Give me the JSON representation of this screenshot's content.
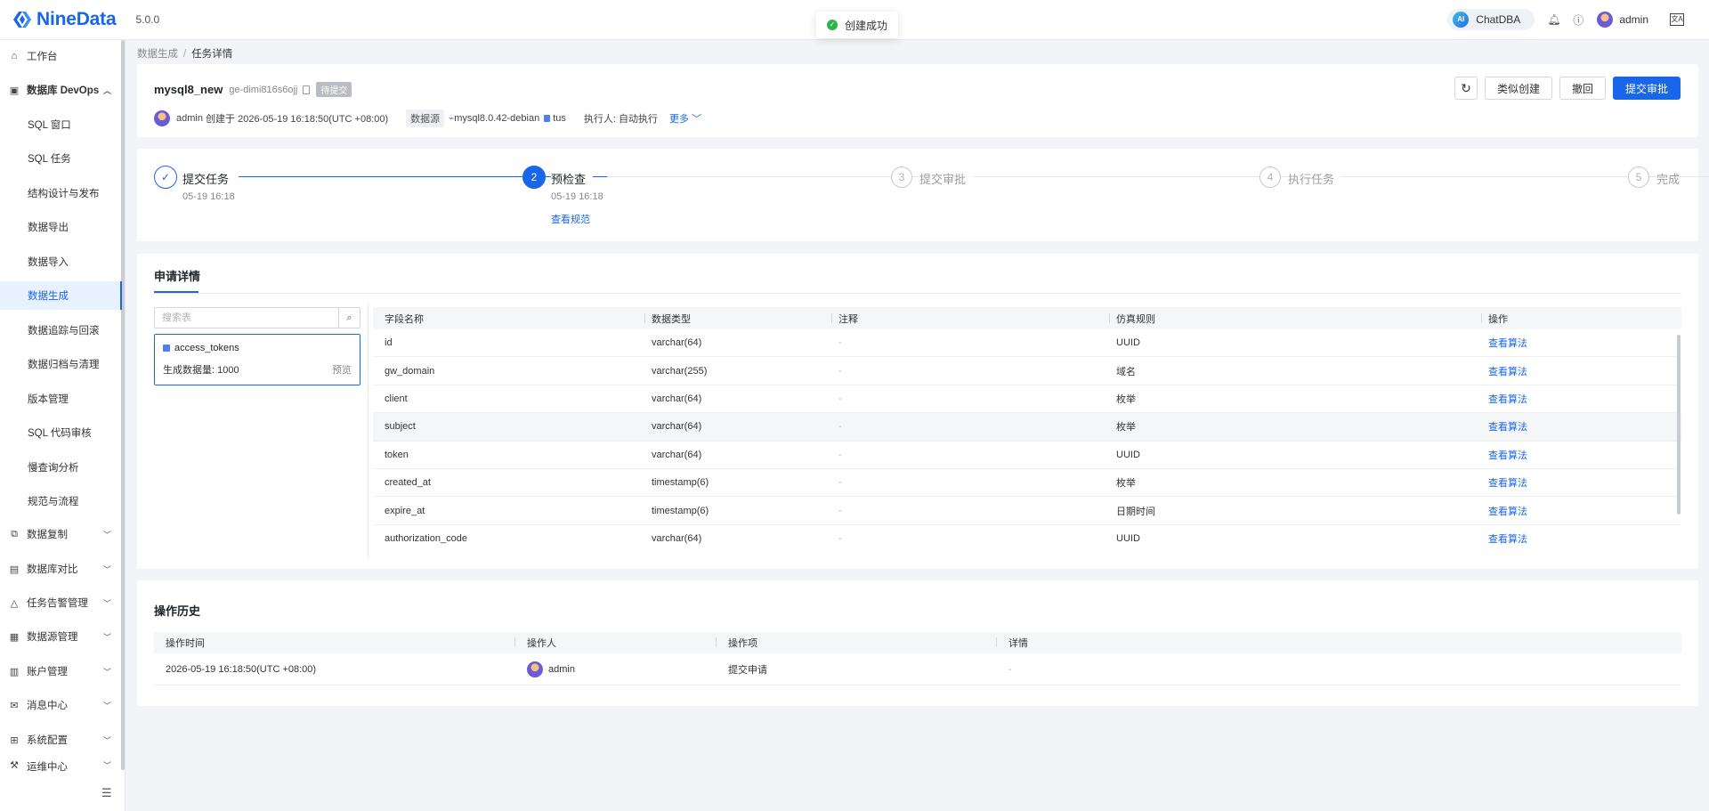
{
  "app": {
    "brand": "NineData",
    "version": "5.0.0",
    "brand_color": "#1a66e8"
  },
  "toast": {
    "message": "创建成功",
    "icon": "check-circle-icon"
  },
  "header": {
    "chatdba_badge": "AI",
    "chatdba_label": "ChatDBA",
    "bell_icon": "bell-icon",
    "help_icon": "help-icon",
    "user_name": "admin",
    "lang_icon": "language-icon"
  },
  "sidebar": {
    "items": [
      {
        "label": "工作台",
        "icon": "home-icon"
      },
      {
        "label": "数据库 DevOps",
        "icon": "devops-icon"
      },
      {
        "label": "SQL 窗口"
      },
      {
        "label": "SQL 任务"
      },
      {
        "label": "结构设计与发布"
      },
      {
        "label": "数据导出"
      },
      {
        "label": "数据导入"
      },
      {
        "label": "数据生成"
      },
      {
        "label": "数据追踪与回滚"
      },
      {
        "label": "数据归档与清理"
      },
      {
        "label": "版本管理"
      },
      {
        "label": "SQL 代码审核"
      },
      {
        "label": "慢查询分析"
      },
      {
        "label": "规范与流程"
      },
      {
        "label": "数据复制",
        "icon": "replication-icon"
      },
      {
        "label": "数据库对比",
        "icon": "compare-icon"
      },
      {
        "label": "任务告警管理",
        "icon": "alarm-icon"
      },
      {
        "label": "数据源管理",
        "icon": "datasource-icon"
      },
      {
        "label": "账户管理",
        "icon": "account-icon"
      },
      {
        "label": "消息中心",
        "icon": "mail-icon"
      },
      {
        "label": "系统配置",
        "icon": "grid-icon"
      },
      {
        "label": "运维中心",
        "icon": "tool-icon"
      }
    ]
  },
  "breadcrumb": {
    "parent": "数据生成",
    "separator": "/",
    "current": "任务详情"
  },
  "task": {
    "name": "mysql8_new",
    "id": "ge-dimi816s6ojj",
    "status": "待提交",
    "creator": "admin",
    "created_text": "创建于 2026-05-19 16:18:50(UTC +08:00)",
    "datasource_label": "数据源",
    "datasource": "mysql8.0.42-debian",
    "database": "tus",
    "executor_label": "执行人:",
    "executor": "自动执行",
    "more": "更多"
  },
  "actions": {
    "refresh_icon": "refresh-icon",
    "similar": "类似创建",
    "revoke": "撤回",
    "submit": "提交审批"
  },
  "steps": [
    {
      "index": "1",
      "label": "提交任务",
      "time": "05-19 16:18",
      "state": "done"
    },
    {
      "index": "2",
      "label": "预检查",
      "time": "05-19 16:18",
      "link": "查看规范",
      "state": "active"
    },
    {
      "index": "3",
      "label": "提交审批",
      "state": "pending"
    },
    {
      "index": "4",
      "label": "执行任务",
      "state": "pending"
    },
    {
      "index": "5",
      "label": "完成",
      "state": "pending"
    }
  ],
  "details": {
    "title": "申请详情",
    "search_placeholder": "搜索表",
    "table": {
      "name": "access_tokens",
      "count_label": "生成数据量: 1000",
      "preview": "预览"
    },
    "columns": [
      "字段名称",
      "数据类型",
      "注释",
      "仿真规则",
      "操作"
    ],
    "rows": [
      {
        "field": "id",
        "type": "varchar(64)",
        "comment": "-",
        "rule": "UUID",
        "action": "查看算法"
      },
      {
        "field": "gw_domain",
        "type": "varchar(255)",
        "comment": "-",
        "rule": "域名",
        "action": "查看算法"
      },
      {
        "field": "client",
        "type": "varchar(64)",
        "comment": "-",
        "rule": "枚举",
        "action": "查看算法"
      },
      {
        "field": "subject",
        "type": "varchar(64)",
        "comment": "-",
        "rule": "枚举",
        "action": "查看算法"
      },
      {
        "field": "token",
        "type": "varchar(64)",
        "comment": "-",
        "rule": "UUID",
        "action": "查看算法"
      },
      {
        "field": "created_at",
        "type": "timestamp(6)",
        "comment": "-",
        "rule": "枚举",
        "action": "查看算法"
      },
      {
        "field": "expire_at",
        "type": "timestamp(6)",
        "comment": "-",
        "rule": "日期时间",
        "action": "查看算法"
      },
      {
        "field": "authorization_code",
        "type": "varchar(64)",
        "comment": "-",
        "rule": "UUID",
        "action": "查看算法"
      }
    ]
  },
  "history": {
    "title": "操作历史",
    "columns": [
      "操作时间",
      "操作人",
      "操作项",
      "详情"
    ],
    "rows": [
      {
        "time": "2026-05-19 16:18:50(UTC +08:00)",
        "operator": "admin",
        "item": "提交申请",
        "detail": "-"
      }
    ]
  }
}
